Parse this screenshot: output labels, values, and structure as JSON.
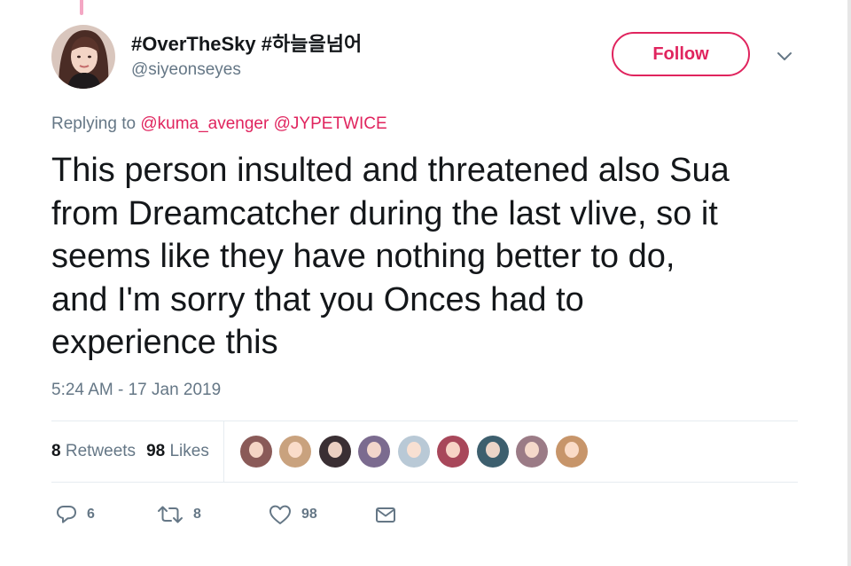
{
  "author": {
    "display_name": "#OverTheSky #하늘을넘어",
    "handle": "@siyeonseyes",
    "avatar_icon": "profile-photo"
  },
  "follow_label": "Follow",
  "menu_icon": "chevron-down-icon",
  "reply": {
    "prefix": "Replying to",
    "mentions": [
      "@kuma_avenger",
      "@JYPETWICE"
    ]
  },
  "tweet": {
    "lines": [
      "This person insulted and threatened also Sua",
      "from Dreamcatcher during the last vlive, so it",
      "seems like they have nothing better to do,",
      "and I'm sorry that you Onces had to",
      "experience this"
    ],
    "timestamp": "5:24 AM - 17 Jan 2019"
  },
  "stats": {
    "retweets_count": "8",
    "retweets_label": "Retweets",
    "likes_count": "98",
    "likes_label": "Likes"
  },
  "likers": [
    {
      "name": "liker-1",
      "color": "#8a5a58"
    },
    {
      "name": "liker-2",
      "color": "#c9a27e"
    },
    {
      "name": "liker-3",
      "color": "#3a2f33"
    },
    {
      "name": "liker-4",
      "color": "#7b6b8f"
    },
    {
      "name": "liker-5",
      "color": "#b9c9d6"
    },
    {
      "name": "liker-6",
      "color": "#a8475a"
    },
    {
      "name": "liker-7",
      "color": "#3d5f6e"
    },
    {
      "name": "liker-8",
      "color": "#9b7b86"
    },
    {
      "name": "liker-9",
      "color": "#c7956a"
    }
  ],
  "actions": {
    "reply_count": "6",
    "retweet_count": "8",
    "like_count": "98"
  },
  "colors": {
    "accent": "#e0245e",
    "text": "#14171a",
    "secondary": "#657786"
  }
}
